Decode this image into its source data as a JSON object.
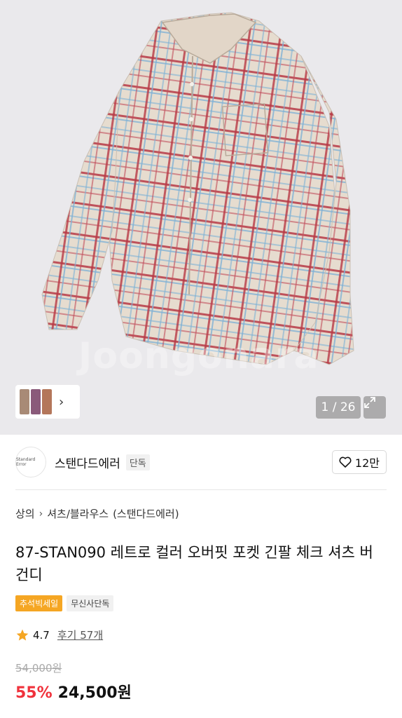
{
  "gallery": {
    "counter": "1 / 26",
    "watermark": "Joongonara",
    "thumbnail_colors": [
      "#a88a76",
      "#8a5a7a",
      "#b4765a"
    ]
  },
  "brand": {
    "logo_text": "Standard Error",
    "name": "스탠다드에러",
    "tag": "단독",
    "likes": "12만"
  },
  "breadcrumb": {
    "category": "상의",
    "subcategory": "셔츠/블라우스",
    "brand": "(스탠다드에러)"
  },
  "product": {
    "title": "87-STAN090 레트로 컬러 오버핏 포켓 긴팔 체크 셔츠 버건디",
    "badges": [
      "추석빅세일",
      "무신사단독"
    ],
    "rating": "4.7",
    "reviews": "후기 57개",
    "original_price": "54,000원",
    "discount": "55%",
    "price": "24,500원"
  },
  "colors": {
    "accent_red": "#f0323c",
    "badge_orange": "#f5a623",
    "star": "#f5a623"
  }
}
